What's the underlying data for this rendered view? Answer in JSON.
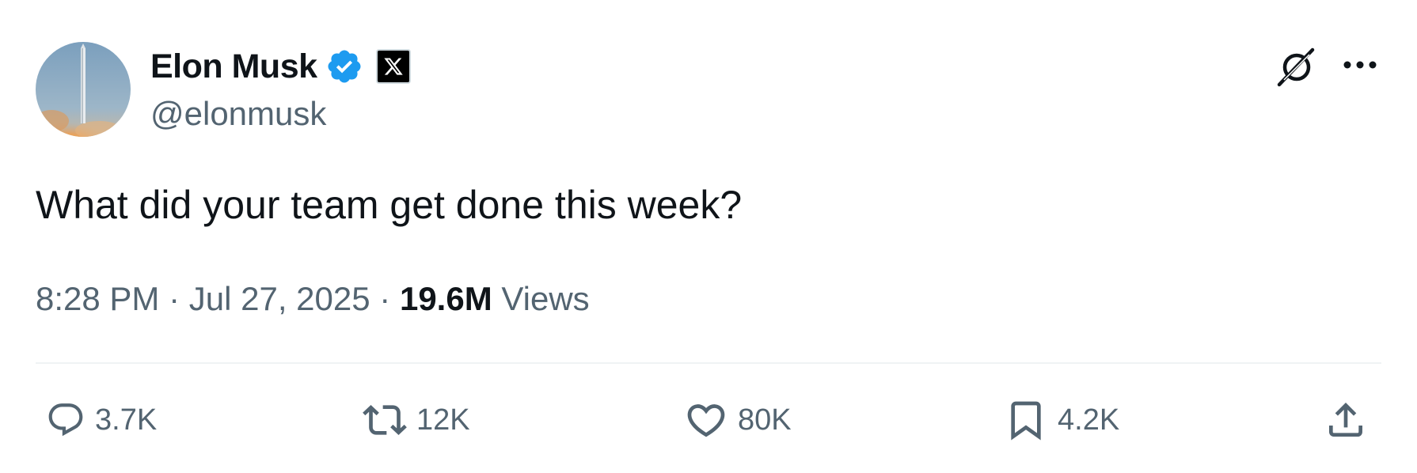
{
  "author": {
    "display_name": "Elon Musk",
    "handle": "@elonmusk",
    "verified": true,
    "verified_color": "#1d9bf0",
    "affiliate_badge": "x-logo-icon"
  },
  "tweet": {
    "text": "What did your team get done this week?"
  },
  "meta": {
    "time": "8:28 PM",
    "separator": "·",
    "date": "Jul 27, 2025",
    "views_count": "19.6M",
    "views_label": "Views"
  },
  "actions": {
    "replies": "3.7K",
    "reposts": "12K",
    "likes": "80K",
    "bookmarks": "4.2K"
  },
  "icons": {
    "top_right": [
      "grok-icon",
      "more-icon"
    ],
    "actions": [
      "reply-icon",
      "repost-icon",
      "like-icon",
      "bookmark-icon",
      "share-icon"
    ]
  },
  "colors": {
    "text_primary": "#0f1419",
    "text_secondary": "#536471",
    "divider": "#eff3f4",
    "verified": "#1d9bf0"
  }
}
